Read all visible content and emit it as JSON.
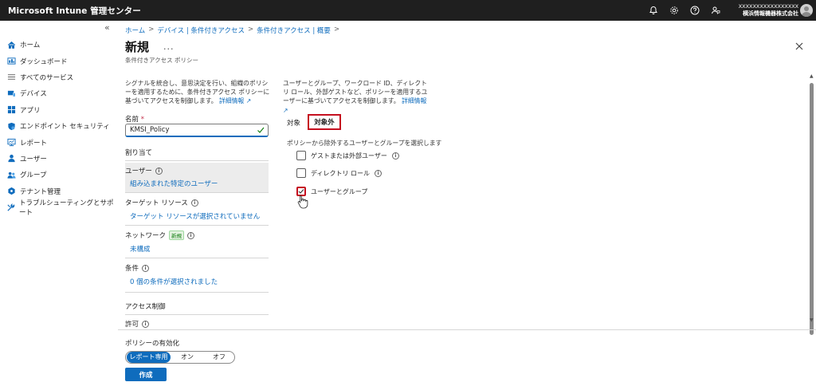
{
  "app": {
    "title": "Microsoft Intune 管理センター",
    "user_name": "xxxxxxxxxxxxxxxxx",
    "user_org": "横浜情報機器株式会社"
  },
  "sidebar": {
    "collapse_glyph": "«",
    "items": [
      {
        "label": "ホーム",
        "icon": "home-icon"
      },
      {
        "label": "ダッシュボード",
        "icon": "dashboard-icon"
      },
      {
        "label": "すべてのサービス",
        "icon": "list-icon"
      },
      {
        "label": "デバイス",
        "icon": "devices-icon"
      },
      {
        "label": "アプリ",
        "icon": "apps-icon"
      },
      {
        "label": "エンドポイント セキュリティ",
        "icon": "shield-icon"
      },
      {
        "label": "レポート",
        "icon": "reports-icon"
      },
      {
        "label": "ユーザー",
        "icon": "user-icon"
      },
      {
        "label": "グループ",
        "icon": "group-icon"
      },
      {
        "label": "テナント管理",
        "icon": "tenant-icon"
      },
      {
        "label": "トラブルシューティングとサポート",
        "icon": "wrench-icon"
      }
    ]
  },
  "breadcrumb": [
    "ホーム",
    "デバイス | 条件付きアクセス",
    "条件付きアクセス | 概要"
  ],
  "header": {
    "title": "新規",
    "more": "...",
    "subtitle": "条件付きアクセス ポリシー"
  },
  "left": {
    "description": "シグナルを統合し、意思決定を行い、組織のポリシーを適用するために、条件付きアクセス ポリシーに基づいてアクセスを制御します。",
    "learn_more": "詳細情報",
    "name_label": "名前",
    "required_mark": "*",
    "name_value": "KMSI_Policy",
    "assignments_label": "割り当て",
    "users_title": "ユーザー",
    "users_link": "組み込まれた特定のユーザー",
    "target_title": "ターゲット リソース",
    "target_link": "ターゲット リソースが選択されていません",
    "network_title": "ネットワーク",
    "network_badge": "新規",
    "network_link": "未構成",
    "conditions_title": "条件",
    "conditions_link": "0 個の条件が選択されました",
    "access_controls_label": "アクセス制御",
    "grant_title": "許可"
  },
  "right": {
    "description": "ユーザーとグループ、ワークロード ID、ディレクトリ ロール、外部ゲストなど、ポリシーを適用するユーザーに基づいてアクセスを制御します。",
    "learn_more": "詳細情報",
    "tab_include": "対象",
    "tab_exclude": "対象外",
    "select_label": "ポリシーから除外するユーザーとグループを選択します",
    "options": [
      {
        "label": "ゲストまたは外部ユーザー",
        "checked": false,
        "info": true
      },
      {
        "label": "ディレクトリ ロール",
        "checked": false,
        "info": true
      },
      {
        "label": "ユーザーとグループ",
        "checked": true,
        "info": false
      }
    ]
  },
  "footer": {
    "enable_label": "ポリシーの有効化",
    "seg_report": "レポート専用",
    "seg_on": "オン",
    "seg_off": "オフ",
    "create_label": "作成"
  },
  "colors": {
    "accent": "#0f6cbd",
    "highlight_red": "#c50f1f",
    "topbar": "#1f1f1f"
  }
}
